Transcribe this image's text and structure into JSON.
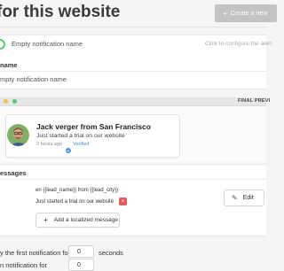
{
  "header": {
    "title": "for this website",
    "create_button": "Create a new"
  },
  "notification": {
    "name": "Empty notification name",
    "configure_hint": "Click to configure the alert"
  },
  "name_section": {
    "label": "name",
    "value": "mpty notification name"
  },
  "preview": {
    "label": "FINAL PREVI",
    "card": {
      "title": "Jack verger from San Francisco",
      "message": "Just started a trial on our website",
      "time": "2 hours ago",
      "verified": "Verified"
    }
  },
  "messages": {
    "label": "essages",
    "language_code": "en {{lead_name}} from {{lead_city}}",
    "variant_text": "Just started a trial on our website",
    "remove_symbol": "×",
    "edit_label": "Edit",
    "add_label": "Add a localized message"
  },
  "timing": {
    "first_prefix": "y the first notification for",
    "first_value": "0",
    "first_suffix": "seconds",
    "second_prefix": "n notification for",
    "second_value": "0"
  },
  "colors": {
    "accent_green": "#5cc76e",
    "danger_red": "#e45a5a",
    "link_blue": "#4a90d9",
    "disabled_gray": "#c3c3c3"
  }
}
